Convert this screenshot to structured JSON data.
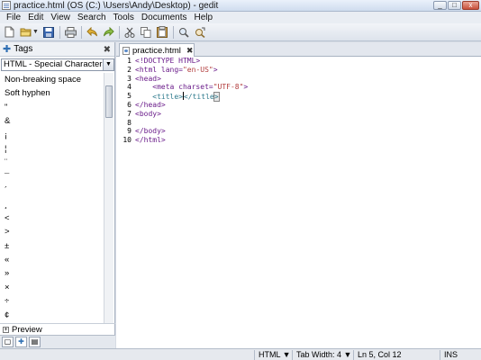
{
  "window": {
    "title": "practice.html (OS (C:) \\Users\\Andy\\Desktop) - gedit",
    "minimize_label": "_",
    "maximize_label": "□",
    "close_label": "x"
  },
  "menu": [
    "File",
    "Edit",
    "View",
    "Search",
    "Tools",
    "Documents",
    "Help"
  ],
  "toolbar": {
    "icons": [
      "new-document-icon",
      "open-folder-icon",
      "open-dropdown-icon",
      "save-icon",
      "print-icon",
      "undo-icon",
      "redo-icon",
      "cut-icon",
      "copy-icon",
      "paste-icon",
      "find-icon",
      "replace-icon"
    ]
  },
  "sidebar": {
    "title": "Tags",
    "close_label": "✖",
    "category": "HTML - Special Characters",
    "items": [
      "Non-breaking space",
      "Soft hyphen",
      "\"",
      "&",
      "¡",
      "¦",
      "¨",
      "¯",
      "´",
      "¸",
      "<",
      ">",
      "±",
      "«",
      "»",
      "×",
      "÷",
      "¢"
    ],
    "preview_label": "Preview"
  },
  "editor": {
    "tab_label": "practice.html",
    "tab_close": "✖",
    "line_numbers": [
      "1",
      "2",
      "3",
      "4",
      "5",
      "6",
      "7",
      "8",
      "9",
      "10"
    ]
  },
  "status": {
    "language": "HTML",
    "tab_width": "Tab Width: 4",
    "position": "Ln 5, Col 12",
    "mode": "INS"
  },
  "colors": {
    "tag": "#6a1c8a",
    "string": "#b23c3c",
    "title_tag": "#2d7a8c"
  }
}
